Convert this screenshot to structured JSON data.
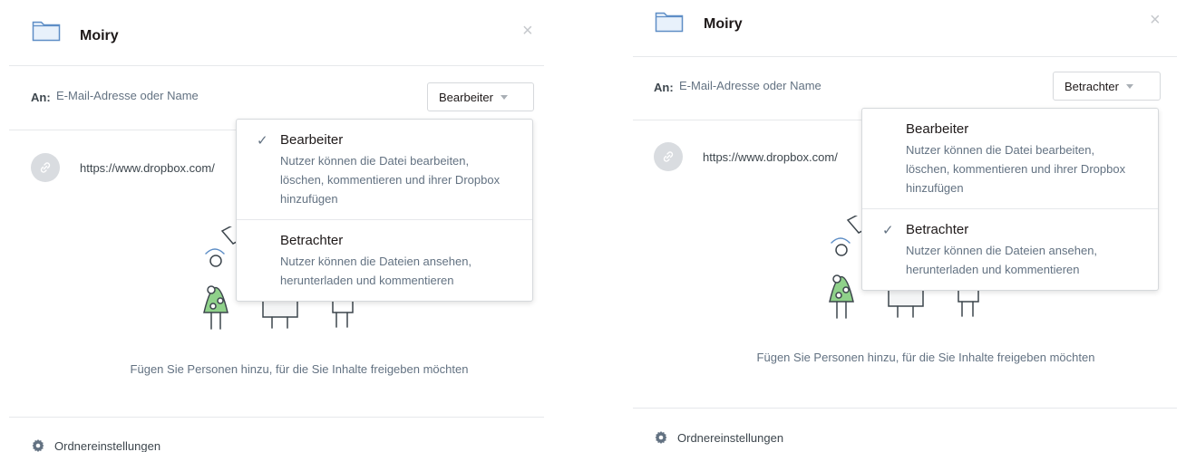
{
  "dialogs": [
    {
      "title": "Moiry",
      "close_symbol": "×",
      "to_label": "An:",
      "to_placeholder": "E-Mail-Adresse oder Name",
      "role_button_label": "Bearbeiter",
      "link_url": "https://www.dropbox.com/",
      "empty_text": "Fügen Sie Personen hinzu, für die Sie Inhalte freigeben möchten",
      "settings_label": "Ordnereinstellungen",
      "dropdown": {
        "items": [
          {
            "title": "Bearbeiter",
            "desc": "Nutzer können die Datei bearbeiten, löschen, kommentieren und ihrer Dropbox hinzufügen",
            "checked": true
          },
          {
            "title": "Betrachter",
            "desc": "Nutzer können die Dateien ansehen, herunterladen und kommentieren",
            "checked": false
          }
        ]
      }
    },
    {
      "title": "Moiry",
      "close_symbol": "×",
      "to_label": "An:",
      "to_placeholder": "E-Mail-Adresse oder Name",
      "role_button_label": "Betrachter",
      "link_url": "https://www.dropbox.com/",
      "empty_text": "Fügen Sie Personen hinzu, für die Sie Inhalte freigeben möchten",
      "settings_label": "Ordnereinstellungen",
      "dropdown": {
        "items": [
          {
            "title": "Bearbeiter",
            "desc": "Nutzer können die Datei bearbeiten, löschen, kommentieren und ihrer Dropbox hinzufügen",
            "checked": false
          },
          {
            "title": "Betrachter",
            "desc": "Nutzer können die Dateien ansehen, herunterladen und kommentieren",
            "checked": true
          }
        ]
      }
    }
  ],
  "check_symbol": "✓",
  "icons": {
    "folder": "folder-icon",
    "close": "close-icon",
    "link": "link-icon",
    "gear": "gear-icon",
    "caret": "chevron-down-icon",
    "check": "check-icon"
  },
  "colors": {
    "folder_fill": "#e8f1fb",
    "folder_stroke": "#5e8ec6",
    "divider": "#e6e8eb",
    "muted_text": "#637282",
    "illustration_green": "#8fd18a"
  }
}
